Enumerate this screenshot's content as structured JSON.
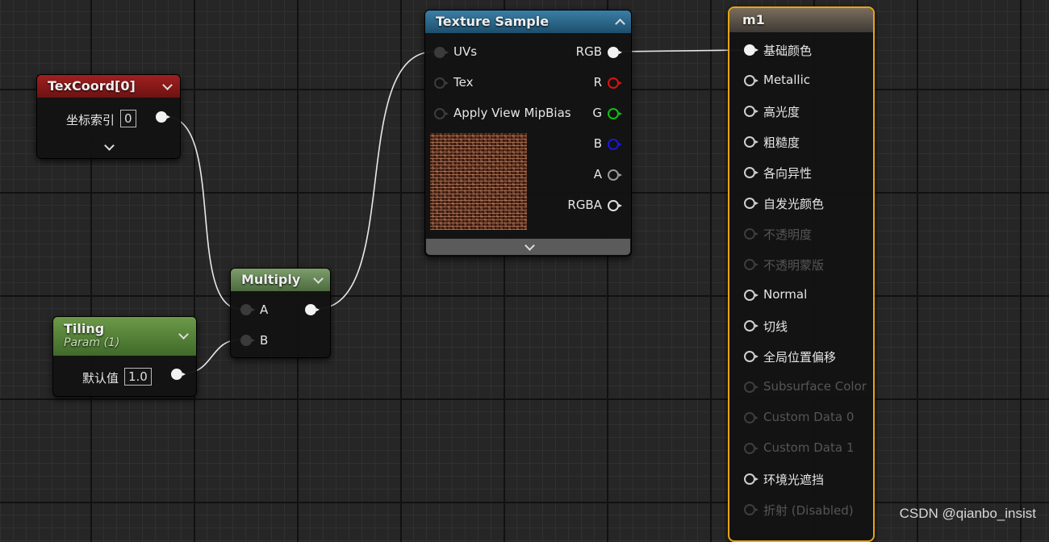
{
  "texcoord": {
    "title": "TexCoord[0]",
    "index_label": "坐标索引",
    "index_value": "0",
    "header_color": "#8e1a1a"
  },
  "tiling": {
    "title": "Tiling",
    "subtitle": "Param (1)",
    "default_label": "默认值",
    "default_value": "1.0",
    "header_color": "#5a8a3c"
  },
  "multiply": {
    "title": "Multiply",
    "input_a": "A",
    "input_b": "B",
    "header_color": "#6e8f5f"
  },
  "texture_sample": {
    "title": "Texture Sample",
    "inputs": [
      "UVs",
      "Tex",
      "Apply View MipBias"
    ],
    "outputs": [
      "RGB",
      "R",
      "G",
      "B",
      "A",
      "RGBA"
    ],
    "header_color": "#2e6a8c",
    "output_colors": [
      "#f2f2f2",
      "#e01010",
      "#10c010",
      "#1818e0",
      "#9a9a9a",
      "#f2f2f2"
    ]
  },
  "material": {
    "title": "m1",
    "border_color": "#e8a317",
    "pins": [
      {
        "label": "基础颜色",
        "enabled": true
      },
      {
        "label": "Metallic",
        "enabled": true
      },
      {
        "label": "高光度",
        "enabled": true
      },
      {
        "label": "粗糙度",
        "enabled": true
      },
      {
        "label": "各向异性",
        "enabled": true
      },
      {
        "label": "自发光颜色",
        "enabled": true
      },
      {
        "label": "不透明度",
        "enabled": false
      },
      {
        "label": "不透明蒙版",
        "enabled": false
      },
      {
        "label": "Normal",
        "enabled": true
      },
      {
        "label": "切线",
        "enabled": true
      },
      {
        "label": "全局位置偏移",
        "enabled": true
      },
      {
        "label": "Subsurface Color",
        "enabled": false
      },
      {
        "label": "Custom Data 0",
        "enabled": false
      },
      {
        "label": "Custom Data 1",
        "enabled": false
      },
      {
        "label": "环境光遮挡",
        "enabled": true
      },
      {
        "label": "折射 (Disabled)",
        "enabled": false
      }
    ]
  },
  "watermark": "CSDN @qianbo_insist"
}
